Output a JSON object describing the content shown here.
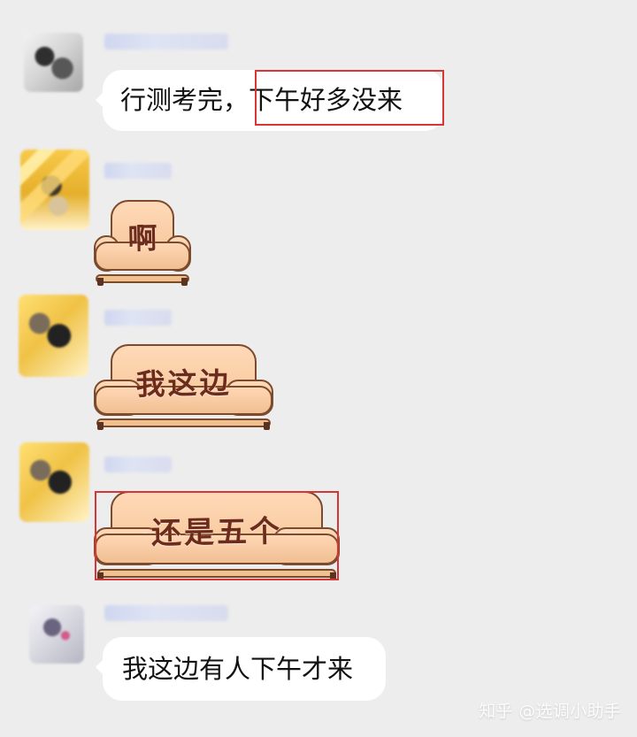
{
  "chat": {
    "messages": [
      {
        "type": "text",
        "sender_avatar": "gray-avatar",
        "text": "行测考完，下午好多没来",
        "highlight_text": "下午好多没来"
      },
      {
        "type": "sticker",
        "sender_avatar": "gold-avatar",
        "sticker_text": "啊"
      },
      {
        "type": "sticker",
        "sender_avatar": "gold-avatar-2",
        "sticker_text": "我这边"
      },
      {
        "type": "sticker",
        "sender_avatar": "gold-avatar-3",
        "sticker_text": "还是五个"
      },
      {
        "type": "text",
        "sender_avatar": "purple-avatar",
        "text": "我这边有人下午才来"
      }
    ]
  },
  "watermark": {
    "text": "知乎 @选调小助手"
  },
  "colors": {
    "background": "#ededed",
    "bubble": "#ffffff",
    "highlight": "#d73636",
    "sticker_text": "#6d2b1c"
  }
}
